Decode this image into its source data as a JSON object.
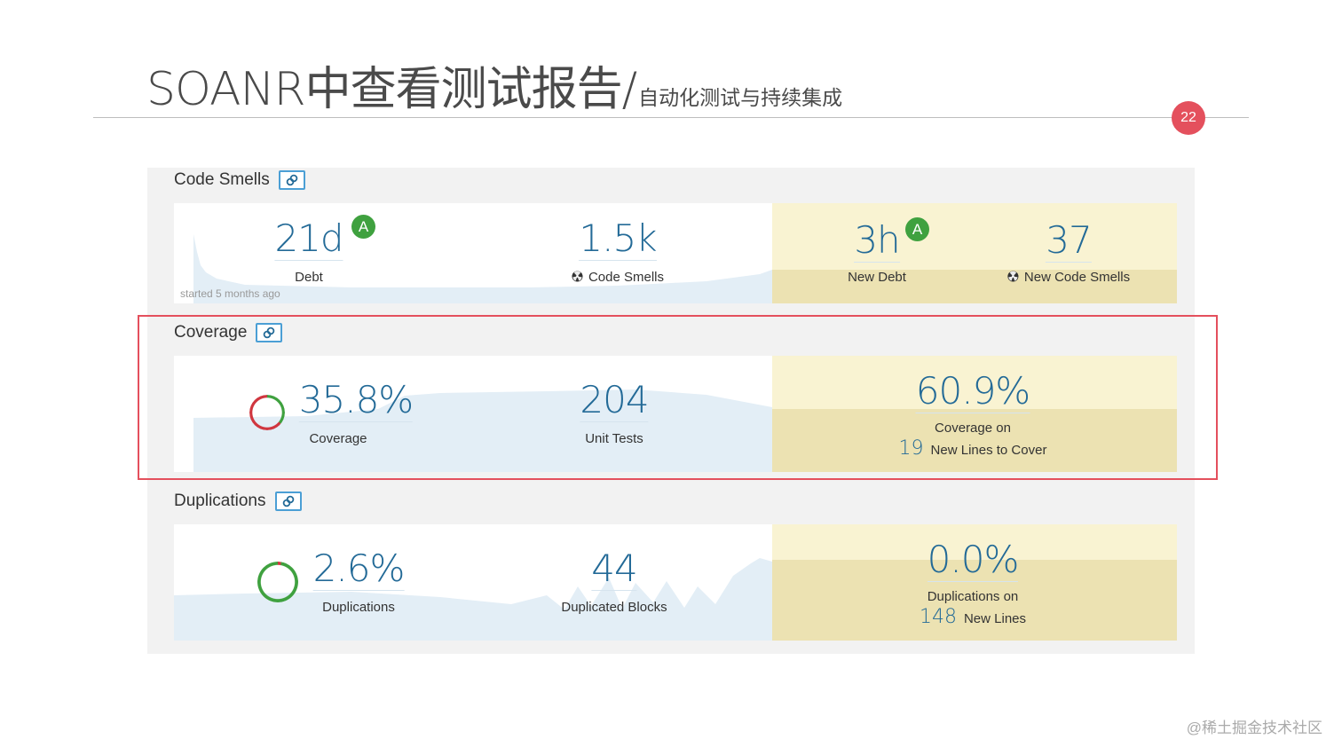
{
  "slide": {
    "title_main": "SOANR中查看测试报告/",
    "title_sub": "自动化测试与持续集成",
    "page_number": "22",
    "watermark": "@稀土掘金技术社区"
  },
  "colors": {
    "accent": "#e4505d",
    "value_blue": "#236a97",
    "rating_green": "#3fa13f",
    "new_code_bg": "#f9f3d2",
    "link_blue": "#4b9fd5"
  },
  "code_smells": {
    "title": "Code Smells",
    "started_note": "started 5 months ago",
    "debt": {
      "value": "21d",
      "label": "Debt",
      "rating": "A"
    },
    "smells": {
      "value": "1.5k",
      "label": "Code Smells",
      "icon": "radiation-icon"
    },
    "new_debt": {
      "value": "3h",
      "label": "New Debt",
      "rating": "A"
    },
    "new_smells": {
      "value": "37",
      "label": "New Code Smells",
      "icon": "radiation-icon"
    }
  },
  "coverage": {
    "title": "Coverage",
    "coverage": {
      "value": "35.8%",
      "label": "Coverage",
      "percent": 35.8
    },
    "unit_tests": {
      "value": "204",
      "label": "Unit Tests"
    },
    "new_coverage": {
      "value": "60.9%",
      "label": "Coverage on",
      "lines_count": "19",
      "lines_label": "New Lines to Cover"
    }
  },
  "duplications": {
    "title": "Duplications",
    "duplications": {
      "value": "2.6%",
      "label": "Duplications",
      "percent": 2.6
    },
    "blocks": {
      "value": "44",
      "label": "Duplicated Blocks"
    },
    "new_dup": {
      "value": "0.0%",
      "label": "Duplications on",
      "lines_count": "148",
      "lines_label": "New Lines"
    }
  }
}
